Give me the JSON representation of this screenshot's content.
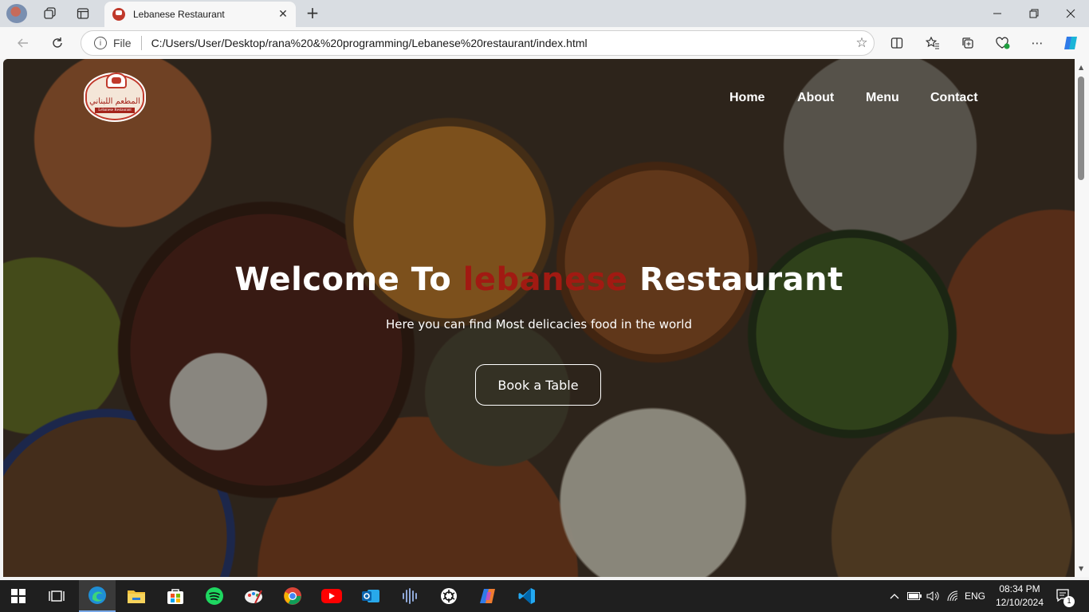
{
  "browser": {
    "tab_title": "Lebanese Restaurant",
    "new_tab_symbol": "+",
    "address": {
      "scheme_label": "File",
      "url": "C:/Users/User/Desktop/rana%20&%20programming/Lebanese%20restaurant/index.html"
    }
  },
  "site": {
    "logo": {
      "arabic": "المطعم اللبناني",
      "english": "Lebanese Restaurant"
    },
    "nav": [
      {
        "label": "Home"
      },
      {
        "label": "About"
      },
      {
        "label": "Menu"
      },
      {
        "label": "Contact"
      }
    ],
    "hero": {
      "title_prefix": "Welcome To ",
      "title_accent": "lebanese",
      "title_suffix": " Restaurant",
      "subtitle": "Here you can find Most delicacies food in the world",
      "cta_label": "Book a Table"
    },
    "accent_color": "#a11a12"
  },
  "taskbar": {
    "apps": [
      "windows-start",
      "task-view",
      "edge",
      "file-explorer",
      "microsoft-store",
      "spotify",
      "paint",
      "chrome",
      "youtube",
      "outlook",
      "audio-app",
      "chatgpt",
      "copilot",
      "vscode"
    ],
    "tray": {
      "language": "ENG",
      "time": "08:34 PM",
      "date": "12/10/2024",
      "notification_count": "1"
    }
  }
}
